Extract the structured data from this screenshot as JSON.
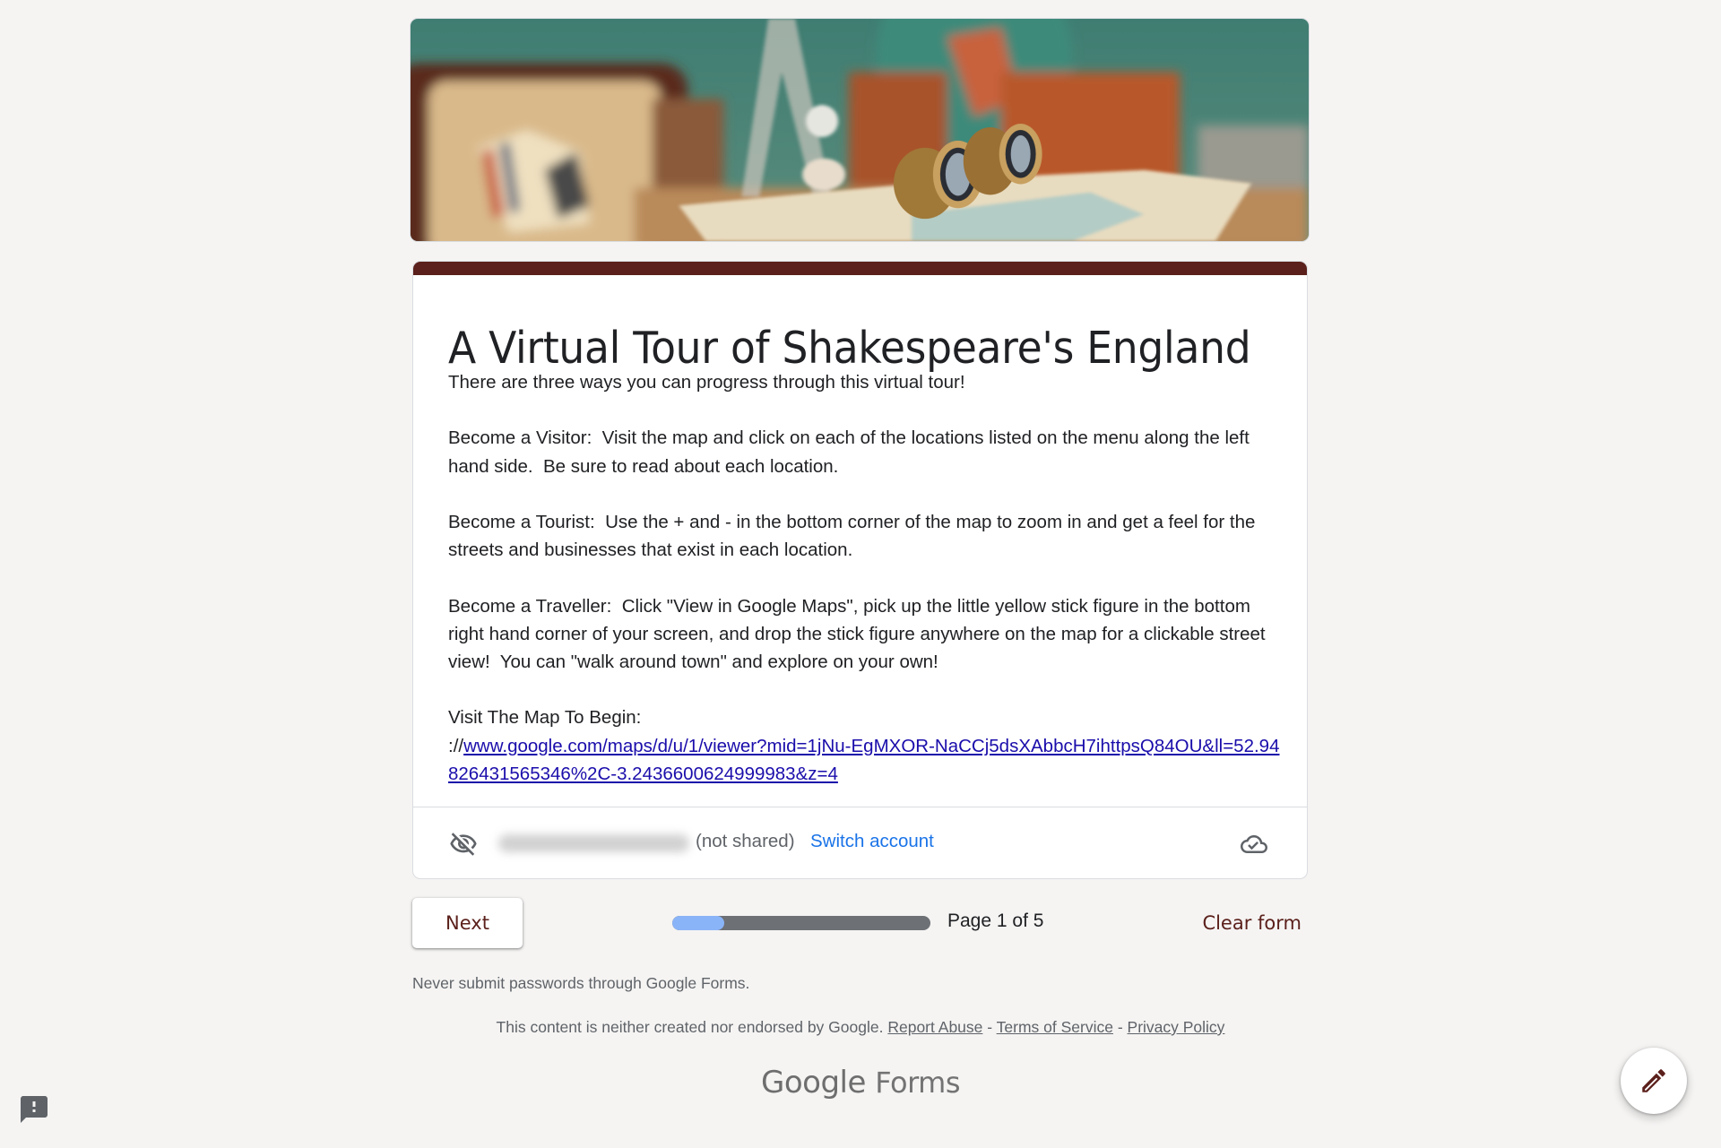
{
  "banner": {
    "image_description": "vintage travel still life: suitcase, Eiffel tower model, globe, brass binoculars on a map"
  },
  "theme": {
    "accent": "#5b201b",
    "link": "#1a0dab",
    "switch_link": "#1a73e8",
    "progress_fill": "#8ab4f8",
    "progress_track": "#6d7075",
    "background": "#f5f4f3"
  },
  "form": {
    "title": "A Virtual Tour of Shakespeare's England",
    "description": {
      "intro": "There are three ways you can progress through this virtual tour!",
      "visitor": "Become a Visitor:  Visit the map and click on each of the locations listed on the menu along the left hand side.  Be sure to read about each location.",
      "tourist": "Become a Tourist:  Use the + and - in the bottom corner of the map to zoom in and get a feel for the streets and businesses that exist in each location.",
      "traveller": "Become a Traveller:  Click \"View in Google Maps\", pick up the little yellow stick figure in the bottom right hand corner of your screen, and drop the stick figure anywhere on the map for a clickable street view!  You can \"walk around town\" and explore on your own!",
      "map_label": "Visit The Map To Begin:",
      "link_prefix": "://",
      "link_text": "www.google.com/maps/d/u/1/viewer?mid=1jNu-EgMXOR-NaCCj5dsXAbbcH7ihttpsQ84OU&ll=52.94826431565346%2C-3.2436600624999983&z=4"
    },
    "account": {
      "email": "(blurred email)@gmail.com",
      "not_shared": "(not shared)",
      "switch_account": "Switch account"
    }
  },
  "nav": {
    "next_label": "Next",
    "progress_fraction": 0.2,
    "page_label": "Page 1 of 5",
    "clear_label": "Clear form"
  },
  "footer": {
    "never_submit": "Never submit passwords through Google Forms.",
    "disclaimer": "This content is neither created nor endorsed by Google.",
    "report_abuse": "Report Abuse",
    "sep1": " - ",
    "terms": "Terms of Service",
    "sep2": " - ",
    "privacy": "Privacy Policy",
    "logo_google": "Google",
    "logo_forms": "Forms"
  },
  "icons": {
    "visibility_off": "eye-off-icon",
    "cloud_done": "cloud-check-icon",
    "edit": "pencil-icon",
    "feedback": "feedback-icon"
  }
}
